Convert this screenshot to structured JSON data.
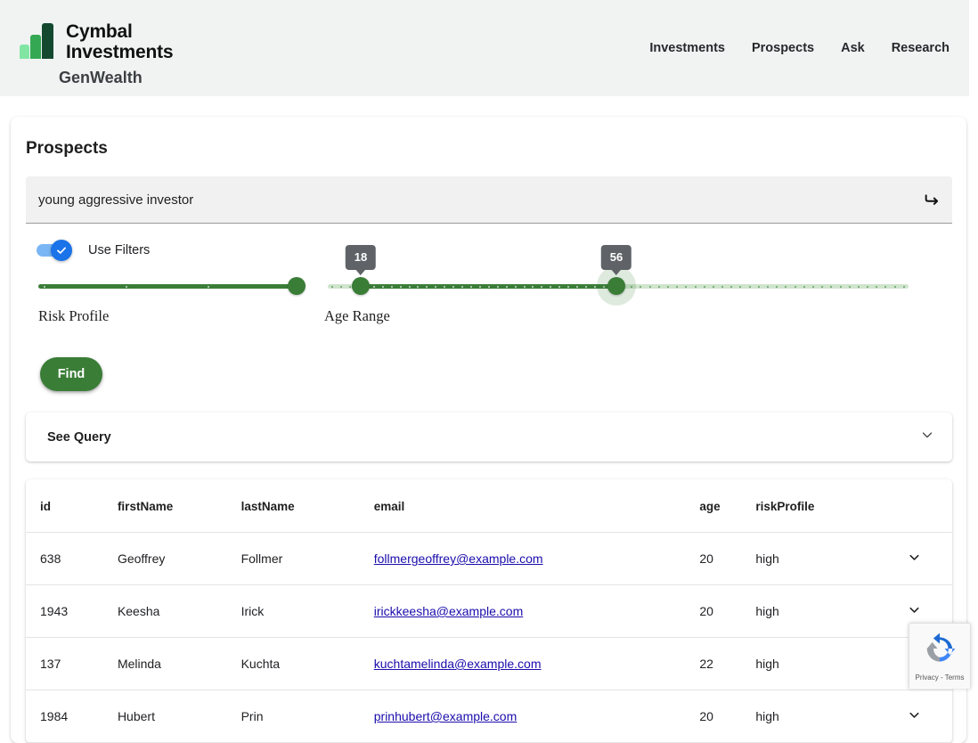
{
  "header": {
    "brand_line1": "Cymbal",
    "brand_line2": "Investments",
    "app_name": "GenWealth",
    "logo_icon": "bar-chart-logo-icon",
    "nav": [
      {
        "label": "Investments"
      },
      {
        "label": "Prospects"
      },
      {
        "label": "Ask"
      },
      {
        "label": "Research"
      }
    ]
  },
  "main": {
    "card_title": "Prospects",
    "search": {
      "value": "young aggressive investor",
      "placeholder": "",
      "submit_icon": "enter-return-arrow-icon"
    },
    "filters": {
      "toggle_label": "Use Filters",
      "toggle_on": true,
      "toggle_icon": "check-icon",
      "accent_color": "#1a73e8"
    },
    "sliders": {
      "risk_profile": {
        "caption": "Risk Profile",
        "value": 3,
        "min": 0,
        "max": 3,
        "fill_percent": 100
      },
      "age_range": {
        "caption": "Age Range",
        "min_value": "18",
        "max_value": "56",
        "min": 18,
        "max": 100,
        "start_percent": 4,
        "end_percent": 48
      },
      "track_color": "#3a7d37",
      "track_inactive_color": "#cfe5cd"
    },
    "find_button": {
      "label": "Find",
      "color": "#3a7d37"
    },
    "query_panel": {
      "title": "See Query",
      "expanded": false,
      "chevron_icon": "chevron-down-icon"
    },
    "table": {
      "columns": [
        "id",
        "firstName",
        "lastName",
        "email",
        "age",
        "riskProfile"
      ],
      "expand_icon": "chevron-down-icon",
      "rows": [
        {
          "id": "638",
          "firstName": "Geoffrey",
          "lastName": "Follmer",
          "email": "follmergeoffrey@example.com",
          "age": "20",
          "riskProfile": "high"
        },
        {
          "id": "1943",
          "firstName": "Keesha",
          "lastName": "Irick",
          "email": "irickkeesha@example.com",
          "age": "20",
          "riskProfile": "high"
        },
        {
          "id": "137",
          "firstName": "Melinda",
          "lastName": "Kuchta",
          "email": "kuchtamelinda@example.com",
          "age": "22",
          "riskProfile": "high"
        },
        {
          "id": "1984",
          "firstName": "Hubert",
          "lastName": "Prin",
          "email": "prinhubert@example.com",
          "age": "20",
          "riskProfile": "high"
        }
      ]
    }
  },
  "recaptcha": {
    "text": "Privacy - Terms",
    "icon": "recaptcha-logo-icon"
  }
}
